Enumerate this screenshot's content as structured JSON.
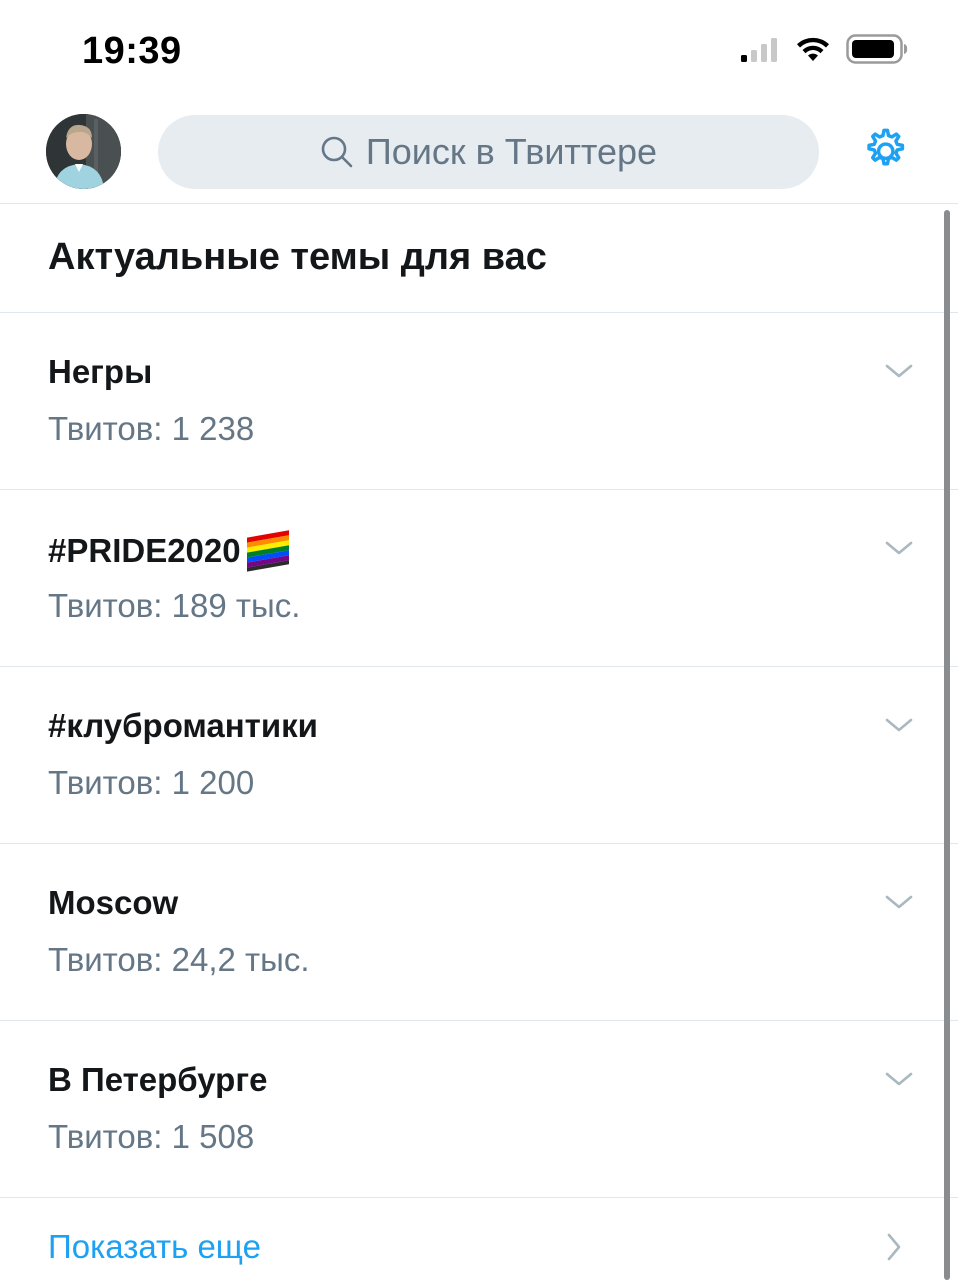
{
  "status_bar": {
    "time": "19:39"
  },
  "header": {
    "search_placeholder": "Поиск в Твиттере"
  },
  "section": {
    "title": "Актуальные темы для вас"
  },
  "trends": [
    {
      "name": "Негры",
      "count": "Твитов: 1 238"
    },
    {
      "name": "#PRIDE2020",
      "count": "Твитов: 189 тыс."
    },
    {
      "name": "#клубромантики",
      "count": "Твитов: 1 200"
    },
    {
      "name": "Moscow",
      "count": "Твитов: 24,2 тыс."
    },
    {
      "name": "В Петербурге",
      "count": "Твитов: 1 508"
    }
  ],
  "show_more": {
    "label": "Показать еще"
  },
  "colors": {
    "accent": "#1da1f2",
    "secondary_text": "#657786",
    "primary_text": "#14171a",
    "search_bg": "#e6ecf0",
    "divider": "#e1e8ed"
  }
}
